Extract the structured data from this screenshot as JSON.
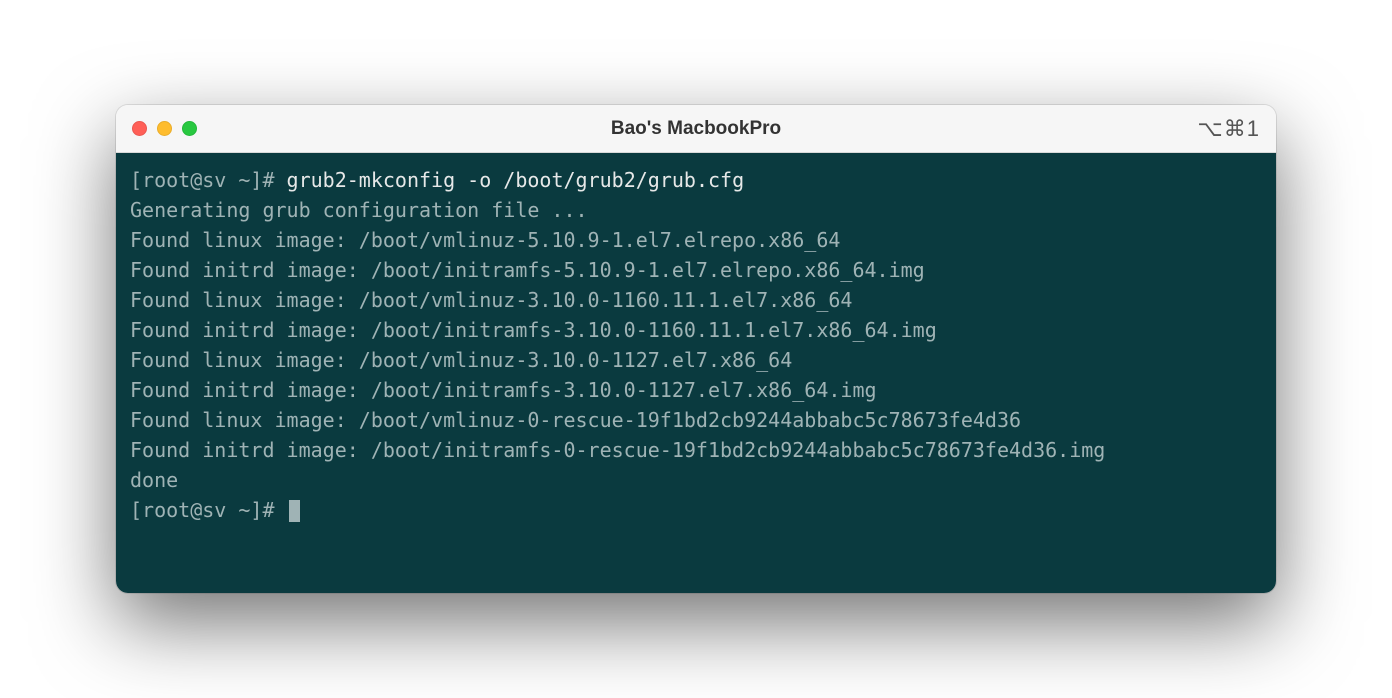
{
  "window": {
    "title": "Bao's MacbookPro",
    "shortcut": "⌥⌘1"
  },
  "terminal": {
    "prompt": "[root@sv ~]# ",
    "command": "grub2-mkconfig -o /boot/grub2/grub.cfg",
    "output": [
      "Generating grub configuration file ...",
      "Found linux image: /boot/vmlinuz-5.10.9-1.el7.elrepo.x86_64",
      "Found initrd image: /boot/initramfs-5.10.9-1.el7.elrepo.x86_64.img",
      "Found linux image: /boot/vmlinuz-3.10.0-1160.11.1.el7.x86_64",
      "Found initrd image: /boot/initramfs-3.10.0-1160.11.1.el7.x86_64.img",
      "Found linux image: /boot/vmlinuz-3.10.0-1127.el7.x86_64",
      "Found initrd image: /boot/initramfs-3.10.0-1127.el7.x86_64.img",
      "Found linux image: /boot/vmlinuz-0-rescue-19f1bd2cb9244abbabc5c78673fe4d36",
      "Found initrd image: /boot/initramfs-0-rescue-19f1bd2cb9244abbabc5c78673fe4d36.img",
      "done"
    ],
    "prompt2": "[root@sv ~]# "
  }
}
